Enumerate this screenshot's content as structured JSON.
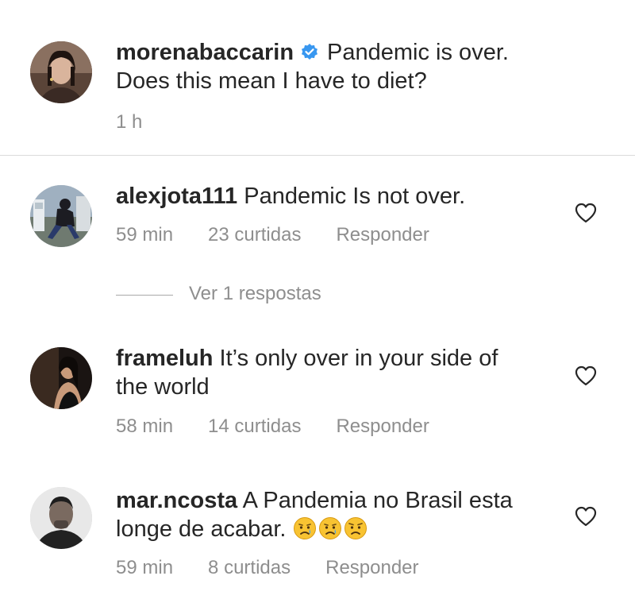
{
  "post": {
    "username": "morenabaccarin",
    "caption_line1": "Pandemic is over.",
    "caption_line2": "Does this mean I have to diet?",
    "time": "1 h",
    "verified": true
  },
  "comments": [
    {
      "username": "alexjota111",
      "text_line1": "Pandemic Is not over.",
      "time": "59 min",
      "likes": "23 curtidas",
      "reply": "Responder",
      "view_replies": "Ver 1 respostas"
    },
    {
      "username": "frameluh",
      "text_line1": "It’s only over in your side of",
      "text_line2": "the world",
      "time": "58 min",
      "likes": "14 curtidas",
      "reply": "Responder"
    },
    {
      "username": "mar.ncosta",
      "text_line1": "A Pandemia no Brasil esta",
      "text_line2": "longe de acabar.",
      "emojis": [
        "crying-face-emoji",
        "crying-face-emoji",
        "worried-face-emoji"
      ],
      "time": "59 min",
      "likes": "8 curtidas",
      "reply": "Responder"
    }
  ],
  "colors": {
    "text": "#262626",
    "secondary": "#8e8e8e",
    "verified_blue": "#3897f0",
    "divider": "#dbdbdb"
  }
}
